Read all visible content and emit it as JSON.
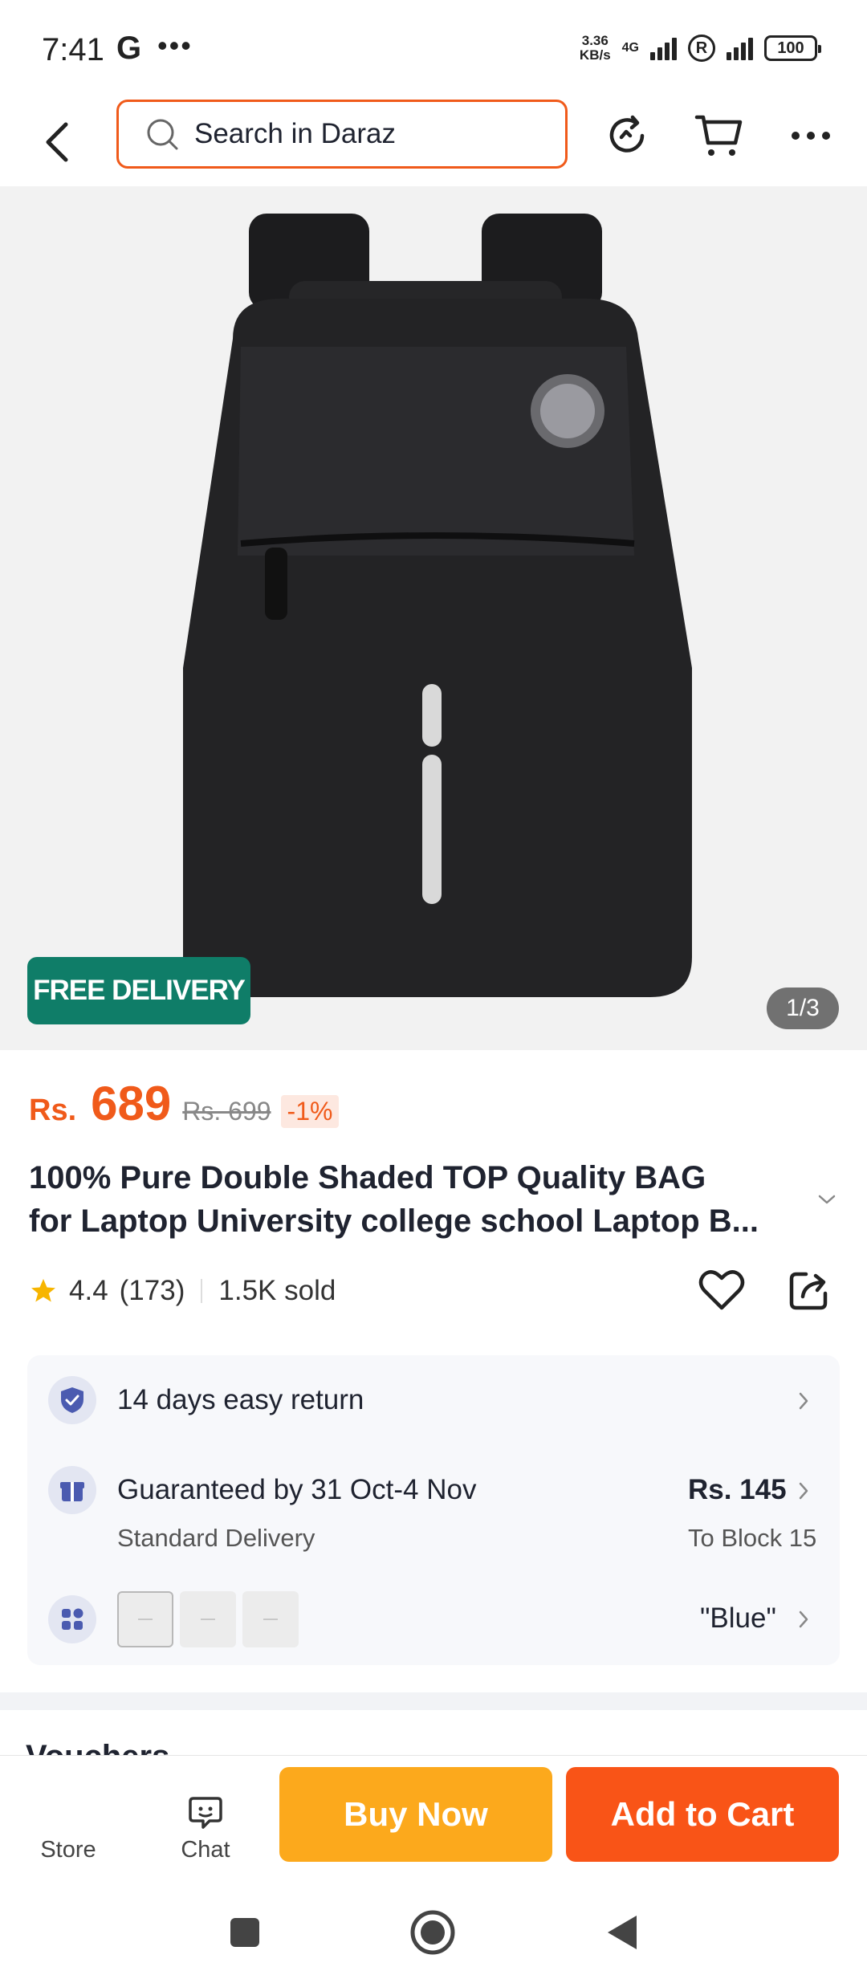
{
  "status_bar": {
    "time": "7:41",
    "g_label": "G",
    "dots": "•••",
    "speed_value": "3.36",
    "speed_unit": "KB/s",
    "network": "4G",
    "r_label": "R",
    "battery": "100"
  },
  "top_nav": {
    "search_placeholder": "Search in Daraz",
    "icons": [
      "back-icon",
      "search-icon",
      "history-icon",
      "cart-icon",
      "more-icon"
    ]
  },
  "hero": {
    "badge": "FREE DELIVERY",
    "counter": "1/3"
  },
  "price": {
    "currency": "Rs.",
    "value": "689",
    "original": "Rs. 699",
    "discount": "-1%"
  },
  "product": {
    "title_line1": "100% Pure Double Shaded TOP Quality BAG",
    "title_line2": "for Laptop University college school Laptop B...",
    "rating": "4.4",
    "reviews": "(173)",
    "sold": "1.5K sold"
  },
  "info": {
    "return_text": "14 days easy return",
    "delivery_text": "Guaranteed by 31 Oct-4 Nov",
    "delivery_sub": "Standard Delivery",
    "delivery_price": "Rs. 145",
    "delivery_location": "To Block 15",
    "variant_value": "\"Blue\""
  },
  "next_section": {
    "title": "Vouchers"
  },
  "bottom_bar": {
    "store_label": "Store",
    "chat_label": "Chat",
    "buy_now": "Buy Now",
    "add_to_cart": "Add to Cart"
  },
  "colors": {
    "accent": "#f05a1a",
    "buy_now": "#fca91c",
    "add_to_cart": "#f95417",
    "free_delivery": "#0f7d68"
  }
}
